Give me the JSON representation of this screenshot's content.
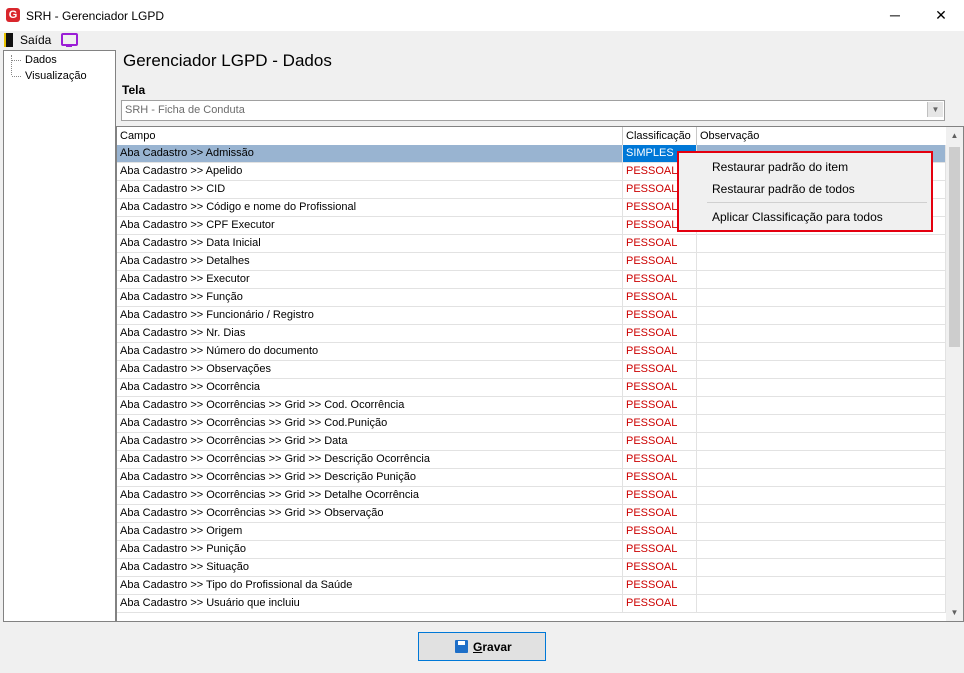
{
  "window": {
    "title": "SRH - Gerenciador LGPD",
    "logo_letter": "G",
    "minimize_glyph": "─",
    "maximize_glyph": "☐",
    "close_glyph": "✕"
  },
  "menu": {
    "exit_label": "Saída",
    "exit_icon": "exit-door-icon",
    "display_icon": "monitor-icon"
  },
  "tree": {
    "items": [
      "Dados",
      "Visualização"
    ]
  },
  "page": {
    "title": "Gerenciador LGPD - Dados",
    "tela_label": "Tela",
    "tela_value": "SRH - Ficha de Conduta",
    "combo_glyph": "▼"
  },
  "grid": {
    "columns": [
      "Campo",
      "Classificação",
      "Observação"
    ],
    "rows": [
      {
        "campo": "Aba Cadastro >> Admissão",
        "classificacao": "SIMPLES",
        "observacao": ""
      },
      {
        "campo": "Aba Cadastro >> Apelido",
        "classificacao": "PESSOAL",
        "observacao": ""
      },
      {
        "campo": "Aba Cadastro >> CID",
        "classificacao": "PESSOAL",
        "observacao": ""
      },
      {
        "campo": "Aba Cadastro >> Código e nome do Profissional",
        "classificacao": "PESSOAL",
        "observacao": ""
      },
      {
        "campo": "Aba Cadastro >> CPF Executor",
        "classificacao": "PESSOAL",
        "observacao": ""
      },
      {
        "campo": "Aba Cadastro >> Data Inicial",
        "classificacao": "PESSOAL",
        "observacao": ""
      },
      {
        "campo": "Aba Cadastro >> Detalhes",
        "classificacao": "PESSOAL",
        "observacao": ""
      },
      {
        "campo": "Aba Cadastro >> Executor",
        "classificacao": "PESSOAL",
        "observacao": ""
      },
      {
        "campo": "Aba Cadastro >> Função",
        "classificacao": "PESSOAL",
        "observacao": ""
      },
      {
        "campo": "Aba Cadastro >> Funcionário / Registro",
        "classificacao": "PESSOAL",
        "observacao": ""
      },
      {
        "campo": "Aba Cadastro >> Nr. Dias",
        "classificacao": "PESSOAL",
        "observacao": ""
      },
      {
        "campo": "Aba Cadastro >> Número do documento",
        "classificacao": "PESSOAL",
        "observacao": ""
      },
      {
        "campo": "Aba Cadastro >> Observações",
        "classificacao": "PESSOAL",
        "observacao": ""
      },
      {
        "campo": "Aba Cadastro >> Ocorrência",
        "classificacao": "PESSOAL",
        "observacao": ""
      },
      {
        "campo": "Aba Cadastro >> Ocorrências >> Grid >> Cod. Ocorrência",
        "classificacao": "PESSOAL",
        "observacao": ""
      },
      {
        "campo": "Aba Cadastro >> Ocorrências >> Grid >> Cod.Punição",
        "classificacao": "PESSOAL",
        "observacao": ""
      },
      {
        "campo": "Aba Cadastro >> Ocorrências >> Grid >> Data",
        "classificacao": "PESSOAL",
        "observacao": ""
      },
      {
        "campo": "Aba Cadastro >> Ocorrências >> Grid >> Descrição Ocorrência",
        "classificacao": "PESSOAL",
        "observacao": ""
      },
      {
        "campo": "Aba Cadastro >> Ocorrências >> Grid >> Descrição Punição",
        "classificacao": "PESSOAL",
        "observacao": ""
      },
      {
        "campo": "Aba Cadastro >> Ocorrências >> Grid >> Detalhe Ocorrência",
        "classificacao": "PESSOAL",
        "observacao": ""
      },
      {
        "campo": "Aba Cadastro >> Ocorrências >> Grid >> Observação",
        "classificacao": "PESSOAL",
        "observacao": ""
      },
      {
        "campo": "Aba Cadastro >> Origem",
        "classificacao": "PESSOAL",
        "observacao": ""
      },
      {
        "campo": "Aba Cadastro >> Punição",
        "classificacao": "PESSOAL",
        "observacao": ""
      },
      {
        "campo": "Aba Cadastro >> Situação",
        "classificacao": "PESSOAL",
        "observacao": ""
      },
      {
        "campo": "Aba Cadastro >> Tipo do Profissional da Saúde",
        "classificacao": "PESSOAL",
        "observacao": ""
      },
      {
        "campo": "Aba Cadastro >> Usuário que incluiu",
        "classificacao": "PESSOAL",
        "observacao": ""
      }
    ],
    "selected_row": 0,
    "scroll_up_glyph": "▲",
    "scroll_down_glyph": "▼"
  },
  "context_menu": {
    "items": [
      "Restaurar padrão do item",
      "Restaurar padrão de todos",
      "Aplicar Classificação para todos"
    ]
  },
  "footer": {
    "save_label": "Gravar",
    "save_icon": "floppy-disk-icon"
  },
  "colors": {
    "accent": "#0078d7",
    "classification_text": "#cc0000",
    "selected_row": "#99b4d1",
    "highlight_border": "#e4000f"
  }
}
